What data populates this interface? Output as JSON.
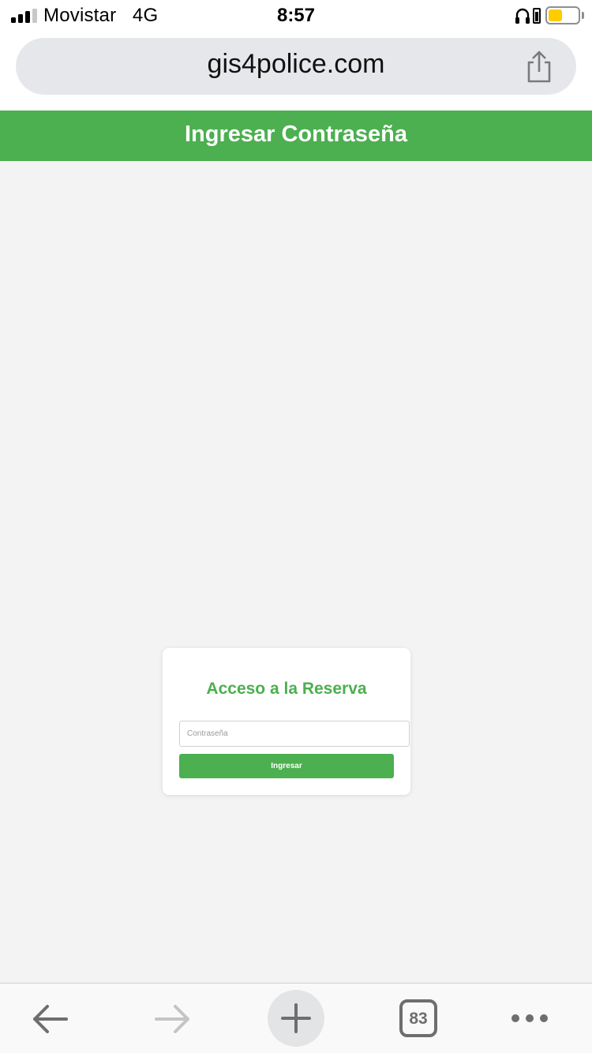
{
  "status_bar": {
    "carrier": "Movistar",
    "network": "4G",
    "time": "8:57",
    "signal_bars": 3,
    "battery_color": "#ffcc00"
  },
  "browser": {
    "url": "gis4police.com",
    "tab_count": "83",
    "icons": [
      "share-icon",
      "back-arrow-icon",
      "forward-arrow-icon",
      "plus-icon",
      "tabs-icon",
      "more-icon"
    ]
  },
  "header": {
    "title": "Ingresar Contraseña",
    "color": "#4caf50"
  },
  "login": {
    "title": "Acceso a la Reserva",
    "password_placeholder": "Contraseña",
    "password_value": "",
    "submit_label": "Ingresar",
    "accent_color": "#4caf50"
  }
}
